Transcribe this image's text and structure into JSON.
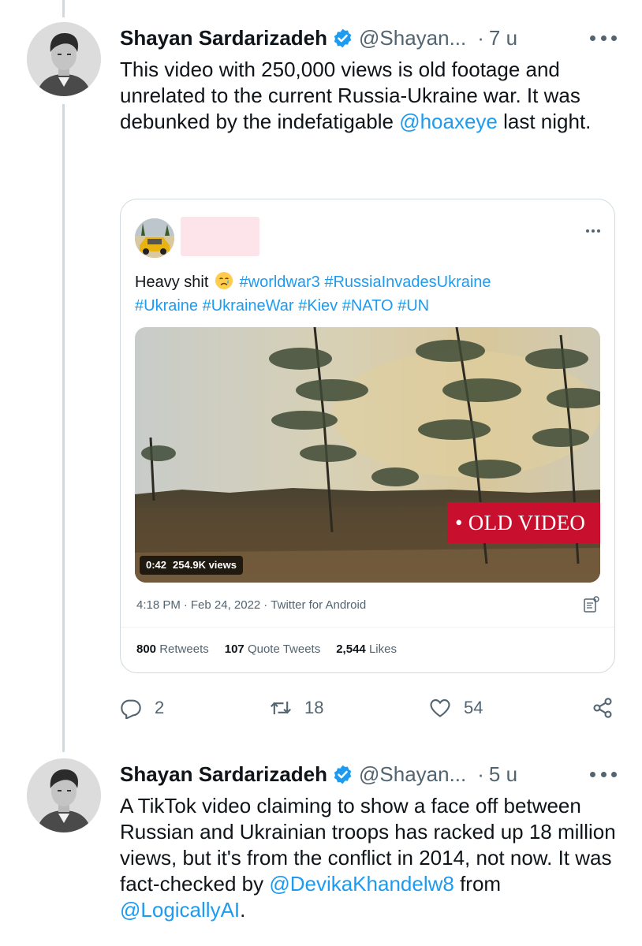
{
  "colors": {
    "accent": "#1d9bf0",
    "text": "#0f1419",
    "secondary": "#536471",
    "border": "#cfd9de",
    "old_video_badge": "#c8102e"
  },
  "tweets": [
    {
      "author_name": "Shayan Sardarizadeh",
      "handle": "@Shayan...",
      "time": "7 u",
      "text_before": "This video with 250,000 views is old footage and unrelated to the current Russia-Ukraine war. It was debunked by the indefatigable ",
      "mention": "@hoaxeye",
      "text_after": " last night.",
      "replies": "2",
      "retweets": "18",
      "likes": "54"
    },
    {
      "author_name": "Shayan Sardarizadeh",
      "handle": "@Shayan...",
      "time": "5 u",
      "text_before": "A TikTok video claiming to show a face off between Russian and Ukrainian troops has racked up 18 million views, but it's from the conflict in 2014, not now. It was fact-checked by ",
      "mention_1": "@DevikaKhandelw8",
      "text_middle": " from ",
      "mention_2": "@LogicallyAI",
      "text_end": "."
    }
  ],
  "quoted_tweet": {
    "text_start": "Heavy shit",
    "hashtags_line1": "#worldwar3 #RussiaInvadesUkraine",
    "hashtags_line2": "#Ukraine #UkraineWar #Kiev #NATO #UN",
    "video_duration": "0:42",
    "video_views": "254.9K views",
    "badge": "• OLD VIDEO",
    "timestamp_time": "4:18 PM",
    "timestamp_date": "Feb 24, 2022",
    "source": "Twitter for Android",
    "stats": {
      "retweets_count": "800",
      "retweets_label": "Retweets",
      "quotes_count": "107",
      "quotes_label": "Quote Tweets",
      "likes_count": "2,544",
      "likes_label": "Likes"
    }
  }
}
